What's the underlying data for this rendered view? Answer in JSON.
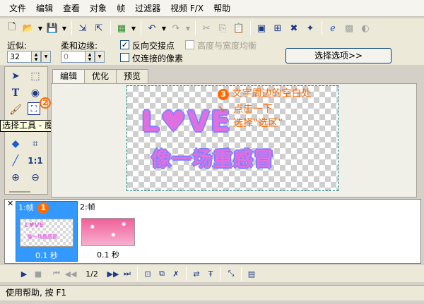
{
  "menu": [
    "文件",
    "编辑",
    "查看",
    "对象",
    "帧",
    "过滤器",
    "视频 F/X",
    "帮助"
  ],
  "options": {
    "tolerance_label": "近似:",
    "tolerance_value": "32",
    "feather_label": "柔和边缘:",
    "feather_value": "0",
    "antialias_label": "反向交接点",
    "antialias_checked": true,
    "equal_label": "高度与宽度均衡",
    "equal_checked": false,
    "contiguous_label": "仅连接的像素",
    "contiguous_checked": false,
    "select_options_button": "选择选项>>"
  },
  "tabs": [
    {
      "label": "编辑",
      "active": true
    },
    {
      "label": "优化",
      "active": false
    },
    {
      "label": "预览",
      "active": false
    }
  ],
  "tools": {
    "tooltip": "选择工具 - 魔术棒",
    "one_to_one": "1:1"
  },
  "canvas": {
    "love_text": "L♥VE",
    "subtitle_text": "像一场重感冒"
  },
  "annotations": {
    "step1": "1",
    "step2": "2",
    "step3": "3",
    "step3_lines": [
      "文字周边的空白处",
      "点击一下",
      "选择“选区”"
    ]
  },
  "frames": [
    {
      "header": "1:帧",
      "time": "0.1 秒",
      "selected": true
    },
    {
      "header": "2:帧",
      "time": "0.1 秒",
      "selected": false
    }
  ],
  "playback": {
    "frame_counter": "1/2"
  },
  "status": "使用帮助, 按 F1",
  "colors": {
    "accent": "#ff6a00",
    "selected_frame": "#3399ff",
    "text_pink": "#e070e0",
    "text_outline": "#8080ff"
  },
  "icons": [
    "new-icon",
    "open-icon",
    "save-icon",
    "import-icon",
    "export-icon",
    "color-icon",
    "undo-icon",
    "redo-icon",
    "cut-icon",
    "copy-icon",
    "paste-icon",
    "prev-frame-icon",
    "insert-frame-icon",
    "delete-icon",
    "effect-icon",
    "browser-icon",
    "disabled-icon",
    "settings-icon"
  ]
}
